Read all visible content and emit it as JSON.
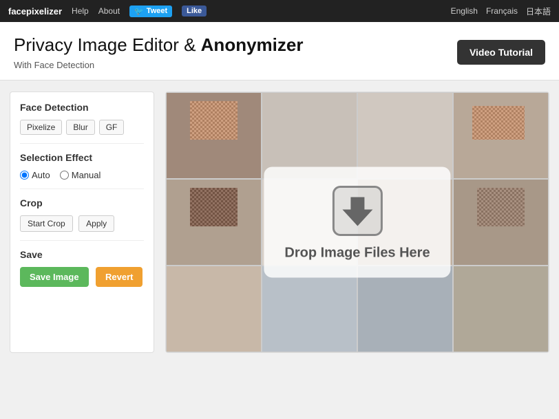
{
  "navbar": {
    "brand": "facepixelizer",
    "links": [
      "Help",
      "About"
    ],
    "tweet_label": "Tweet",
    "like_label": "Like",
    "languages": [
      "English",
      "Français",
      "日本語"
    ]
  },
  "hero": {
    "title_part1": "Privacy Image Editor & ",
    "title_part2": "Anonymizer",
    "subtitle": "With Face Detection",
    "video_button_label": "Video Tutorial"
  },
  "left_panel": {
    "face_detection_title": "Face Detection",
    "pixelize_label": "Pixelize",
    "blur_label": "Blur",
    "gf_label": "GF",
    "selection_effect_title": "Selection Effect",
    "radio_auto": "Auto",
    "radio_manual": "Manual",
    "crop_title": "Crop",
    "start_crop_label": "Start Crop",
    "apply_label": "Apply",
    "save_title": "Save",
    "save_image_label": "Save Image",
    "revert_label": "Revert"
  },
  "drop_zone": {
    "text": "Drop Image Files Here"
  }
}
